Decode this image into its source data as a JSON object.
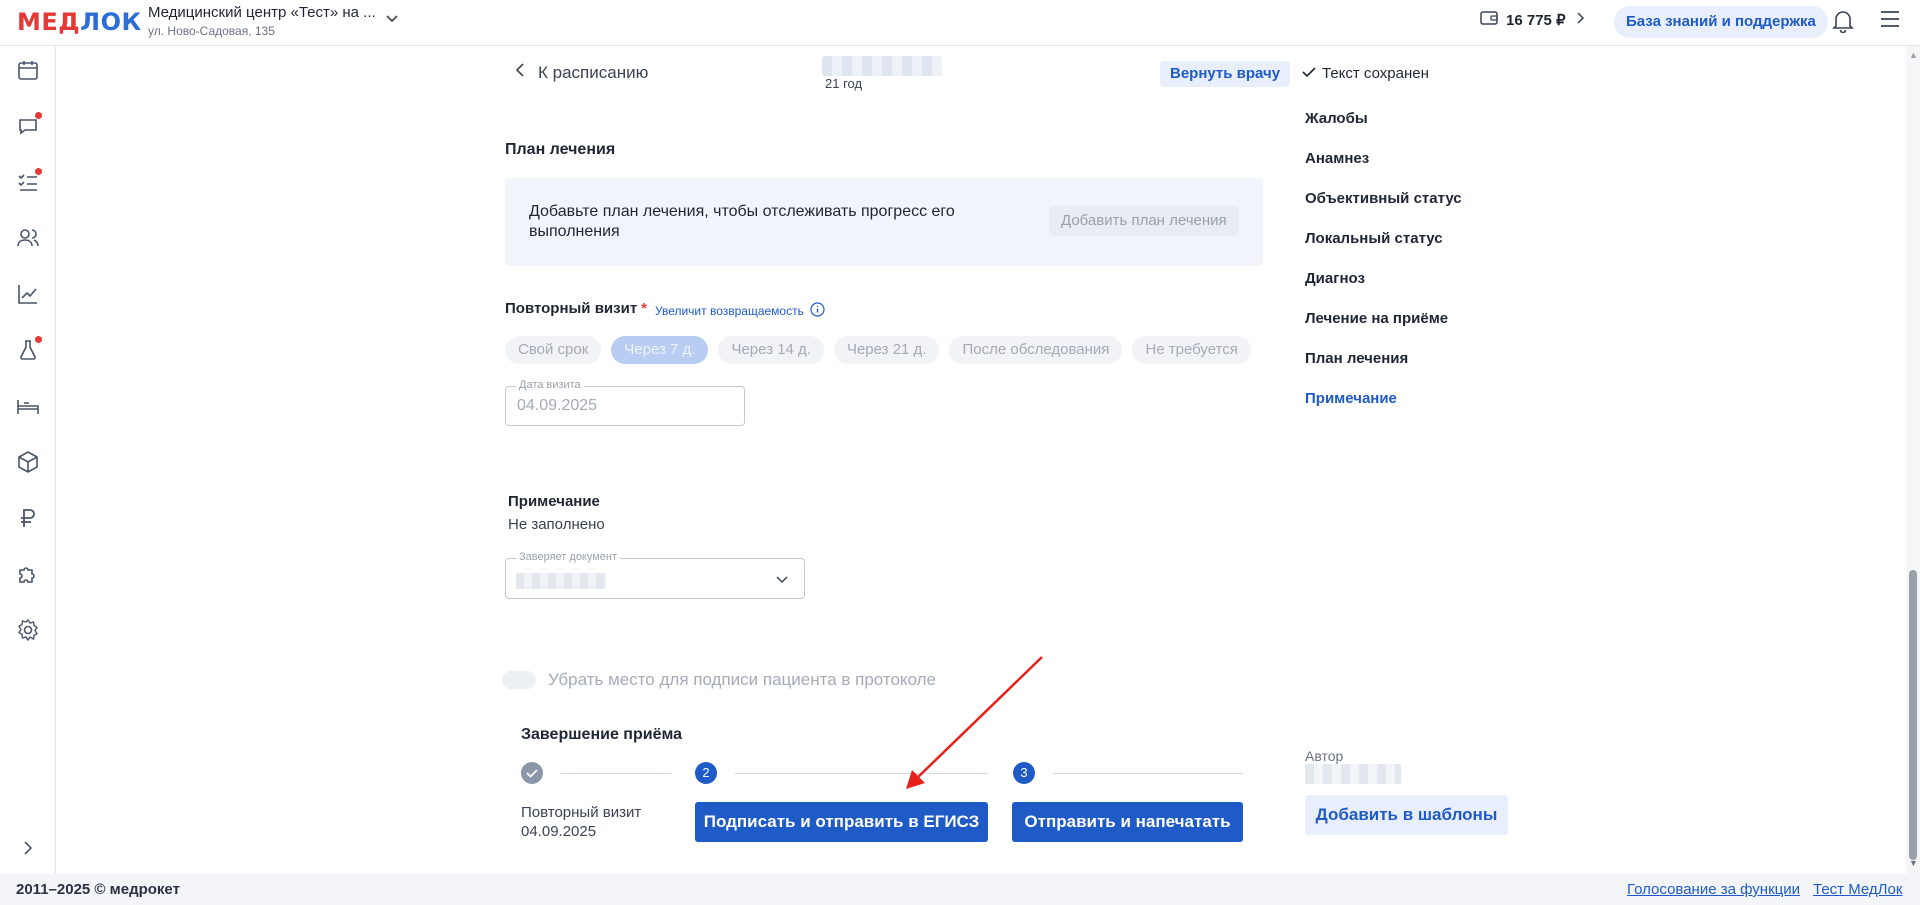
{
  "header": {
    "logo_part1": "МЕД",
    "logo_part2": "ЛОК",
    "clinic_name": "Медицинский центр «Тест» на ...",
    "clinic_address": "ул. Ново-Садовая, 135",
    "balance": "16 775 ₽",
    "help_button": "База знаний и поддержка"
  },
  "sidebar": {
    "icons": [
      "calendar-icon",
      "chat-icon",
      "tasks-icon",
      "patients-icon",
      "analytics-icon",
      "lab-icon",
      "bed-icon",
      "box-icon",
      "ruble-icon",
      "puzzle-icon",
      "settings-icon",
      "expand-icon"
    ]
  },
  "topline": {
    "back_label": "К расписанию",
    "patient_age": "21 год",
    "return_button": "Вернуть врачу",
    "saved_status": "Текст сохранен"
  },
  "anchors": [
    "Жалобы",
    "Анамнез",
    "Объективный статус",
    "Локальный статус",
    "Диагноз",
    "Лечение на приёме",
    "План лечения",
    "Примечание"
  ],
  "anchors_active": "Примечание",
  "plan": {
    "title": "План лечения",
    "text": "Добавьте план лечения, чтобы отслеживать прогресс его выполнения",
    "add_button": "Добавить план лечения"
  },
  "revisit": {
    "title": "Повторный визит",
    "required_mark": "*",
    "returnability_link": "Увеличит возвращаемость",
    "chips": [
      "Свой срок",
      "Через 7 д.",
      "Через 14 д.",
      "Через 21 д.",
      "После обследования",
      "Не требуется"
    ],
    "selected_chip": "Через 7 д.",
    "date_label": "Дата визита",
    "date_value": "04.09.2025"
  },
  "note": {
    "title": "Примечание",
    "value": "Не заполнено",
    "certifier_label": "Заверяет документ"
  },
  "signature_toggle": {
    "label": "Убрать место для подписи пациента в протоколе",
    "enabled": false
  },
  "finish": {
    "title": "Завершение приёма",
    "step1_title": "Повторный визит",
    "step1_date": "04.09.2025",
    "step2_number": "2",
    "step3_number": "3",
    "sign_button": "Подписать и отправить в ЕГИСЗ",
    "print_button": "Отправить и напечатать"
  },
  "author": {
    "label": "Автор",
    "templates_button": "Добавить в шаблоны"
  },
  "footer": {
    "copyright": "2011–2025 © медрокет",
    "vote_link": "Голосование за функции",
    "test_link": "Тест МедЛок"
  },
  "colors": {
    "brand_red": "#e53935",
    "brand_blue": "#1e5bc6",
    "annotation_arrow": "#e8201a"
  }
}
